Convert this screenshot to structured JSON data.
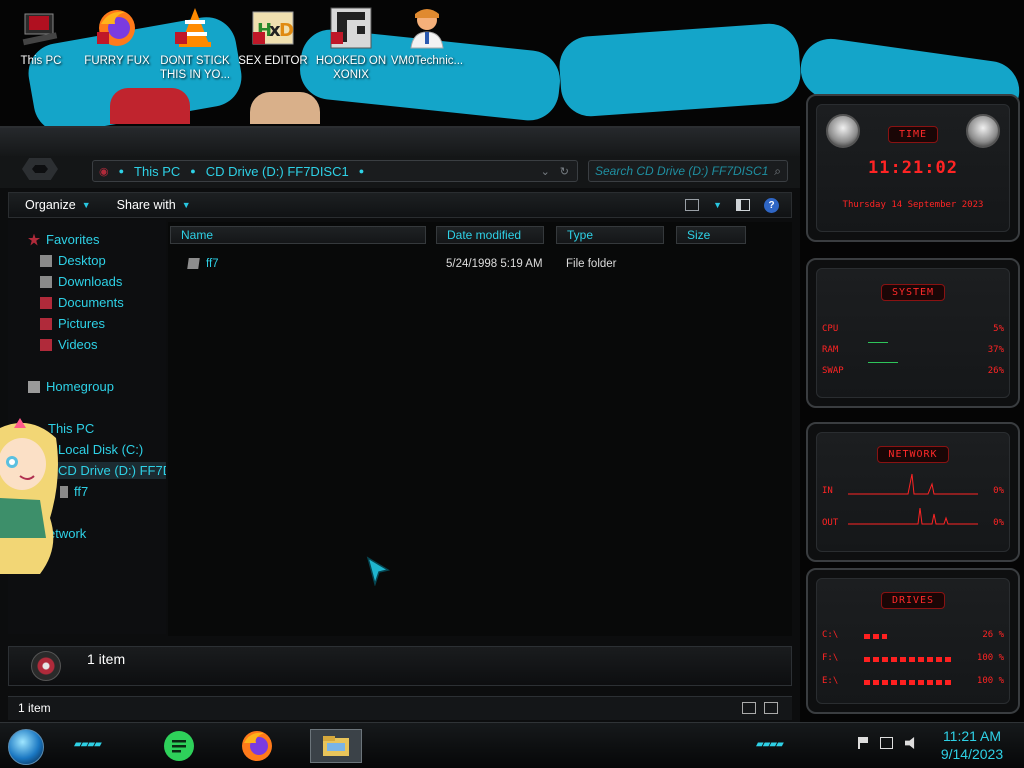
{
  "desktop": {
    "icons": [
      {
        "label": "This PC",
        "icon": "computer-icon"
      },
      {
        "label": "FURRY FUX",
        "icon": "firefox-icon"
      },
      {
        "label": "DONT STICK THIS IN YO...",
        "icon": "vlc-icon"
      },
      {
        "label": "SEX EDITOR",
        "icon": "hxd-hex-editor-icon"
      },
      {
        "label": "HOOKED ON XONIX",
        "icon": "xonix-game-icon"
      },
      {
        "label": "VM0Technic...",
        "icon": "doctor-avatar-icon"
      }
    ]
  },
  "explorer": {
    "address": {
      "crumbs": [
        "This PC",
        "CD Drive (D:) FF7DISC1"
      ]
    },
    "search_placeholder": "Search CD Drive (D:) FF7DISC1",
    "toolbar": {
      "organize": "Organize",
      "share_with": "Share with"
    },
    "nav": {
      "favorites": "Favorites",
      "desktop": "Desktop",
      "downloads": "Downloads",
      "documents": "Documents",
      "pictures": "Pictures",
      "videos": "Videos",
      "homegroup": "Homegroup",
      "this_pc": "This PC",
      "local_disk": "Local Disk (C:)",
      "cd_drive": "CD Drive (D:) FF7D",
      "ff7": "ff7",
      "network": "etwork"
    },
    "columns": {
      "name": "Name",
      "date_modified": "Date modified",
      "type": "Type",
      "size": "Size"
    },
    "files": [
      {
        "name": "ff7",
        "date_modified": "5/24/1998 5:19 AM",
        "type": "File folder",
        "size": ""
      }
    ],
    "details_count": "1 item",
    "status_count": "1 item"
  },
  "gadgets": {
    "time": {
      "title": "TIME",
      "time": "11:21:02",
      "date": "Thursday 14 September 2023"
    },
    "system": {
      "title": "SYSTEM",
      "cpu_label": "CPU",
      "cpu": "5%",
      "ram_label": "RAM",
      "ram": "37%",
      "swap_label": "SWAP",
      "swap": "26%"
    },
    "network": {
      "title": "NETWORK",
      "in_label": "IN",
      "in": "0%",
      "out_label": "OUT",
      "out": "0%"
    },
    "drives": {
      "title": "DRIVES",
      "items": [
        {
          "label": "C:\\",
          "value": "26 %",
          "fill": 0.26
        },
        {
          "label": "F:\\",
          "value": "100 %",
          "fill": 1.0
        },
        {
          "label": "E:\\",
          "value": "100 %",
          "fill": 1.0
        }
      ]
    }
  },
  "taskbar": {
    "apps": [
      "notes-app-icon",
      "firefox-icon",
      "file-explorer-icon"
    ],
    "clock_time": "11:21 AM",
    "clock_date": "9/14/2023"
  },
  "colors": {
    "accent": "#2ed1e6",
    "gadget_red": "#ff2424",
    "wallpaper_blue": "#14a5c9"
  }
}
